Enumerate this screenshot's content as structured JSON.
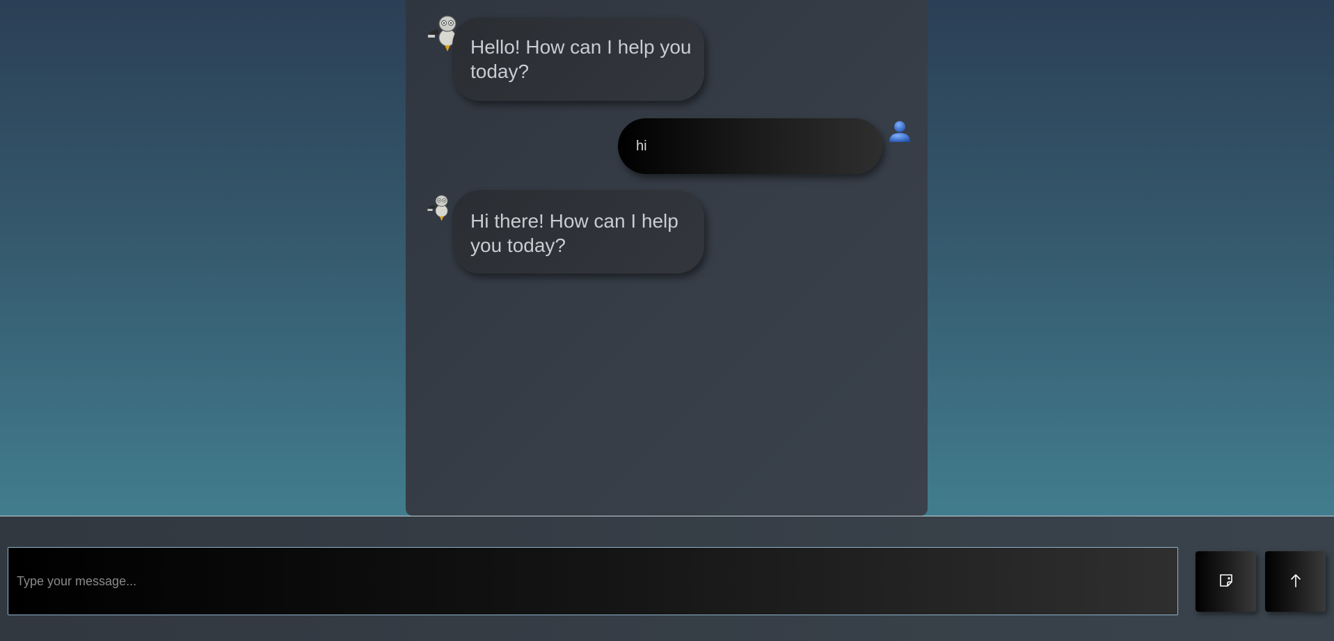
{
  "messages": [
    {
      "sender": "bot",
      "text_line1": "Hello! How can I help you",
      "text_line2": "today?",
      "avatar": "robot-icon"
    },
    {
      "sender": "user",
      "text": "hi",
      "avatar": "user-icon"
    },
    {
      "sender": "bot",
      "text_line1": "Hi there! How can I help",
      "text_line2": "you today?",
      "avatar": "robot-icon"
    }
  ],
  "input": {
    "placeholder": "Type your message...",
    "value": ""
  },
  "buttons": {
    "sticker": "sticker-icon",
    "send": "arrow-up-icon"
  },
  "colors": {
    "background_top": "#2b3f55",
    "background_bottom": "#478d9d",
    "panel": "#343a43",
    "bot_bubble": "#2e3137",
    "input_border": "#8fb4cc"
  }
}
